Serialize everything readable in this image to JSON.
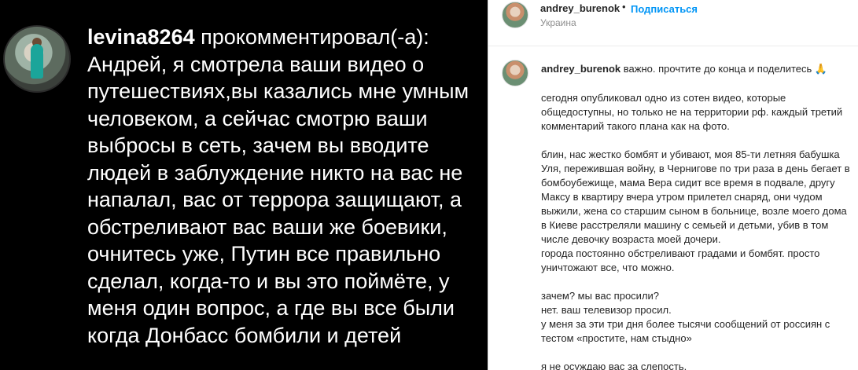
{
  "comment": {
    "username": "levina8264",
    "action": "прокомментировал(-а):",
    "text": "Андрей, я смотрела ваши видео о путешествиях,вы  казались мне умным человеком, а сейчас смотрю ваши выбросы в сеть, зачем вы вводите людей в заблуждение  никто на вас не напалал, вас  от террора защищают, а обстреливают  вас ваши же боевики, очнитесь уже, Путин все правильно сделал, когда-то и вы это поймёте, у меня один вопрос, а где вы все были когда Донбасс бомбили и детей"
  },
  "post_header": {
    "username": "andrey_burenok",
    "separator": "•",
    "follow_label": "Подписаться",
    "location": "Украина"
  },
  "caption": {
    "username": "andrey_burenok",
    "first_line": "важно. прочтите до конца и поделитесь 🙏",
    "body": "сегодня опубликовал одно из сотен видео, которые\nобщедоступны, но только не на территории рф. каждый третий\nкомментарий такого плана как на фото.\n\nблин, нас жестко бомбят и убивают, моя 85-ти летняя бабушка\nУля, пережившая войну, в Чернигове по три раза в день бегает в\nбомбоубежище, мама Вера сидит все время в подвале, другу\nМаксу в квартиру вчера утром прилетел снаряд, они чудом\nвыжили, жена со старшим сыном в больнице, возле моего дома\nв Киеве расстреляли машину с семьей и детьми, убив в том\nчисле девочку возраста моей дочери.\nгорода постоянно обстреливают градами и бомбят. просто\nуничтожают все, что можно.\n\nзачем? мы вас просили?\nнет. ваш телевизор просил.\nу меня за эти три дня более тысячи сообщений от россиян с\nтестом «простите, нам стыдно»\n\nя не осуждаю вас за слепость."
  },
  "colors": {
    "link": "#0095f6",
    "text": "#262626",
    "muted": "#8e8e8e",
    "media_bg": "#000000"
  }
}
